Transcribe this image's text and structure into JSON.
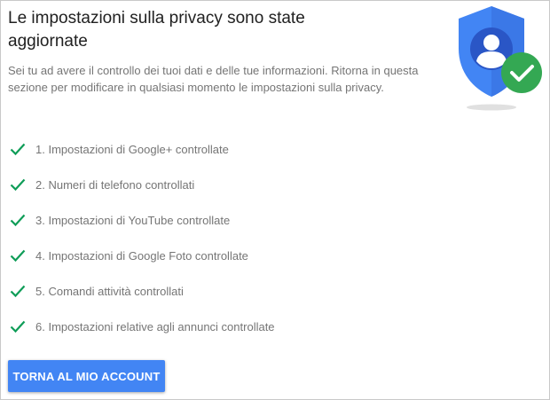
{
  "page": {
    "title": "Le impostazioni sulla privacy sono state aggiornate",
    "description": "Sei tu ad avere il controllo dei tuoi dati e delle tue informazioni. Ritorna in questa sezione per modificare in qualsiasi momento le impostazioni sulla privacy."
  },
  "badge": {
    "icon": "shield-user-check-icon",
    "shield_color": "#4285f4",
    "check_color": "#34a853"
  },
  "checklist": {
    "check_icon": "checkmark-icon",
    "check_color": "#0f9d58",
    "items": [
      {
        "label": "1. Impostazioni di Google+ controllate"
      },
      {
        "label": "2. Numeri di telefono controllati"
      },
      {
        "label": "3. Impostazioni di YouTube controllate"
      },
      {
        "label": "4. Impostazioni di Google Foto controllate"
      },
      {
        "label": "5. Comandi attività controllati"
      },
      {
        "label": "6. Impostazioni relative agli annunci controllate"
      }
    ]
  },
  "actions": {
    "back_label": "TORNA AL MIO ACCOUNT",
    "accent": "#4285f4"
  }
}
